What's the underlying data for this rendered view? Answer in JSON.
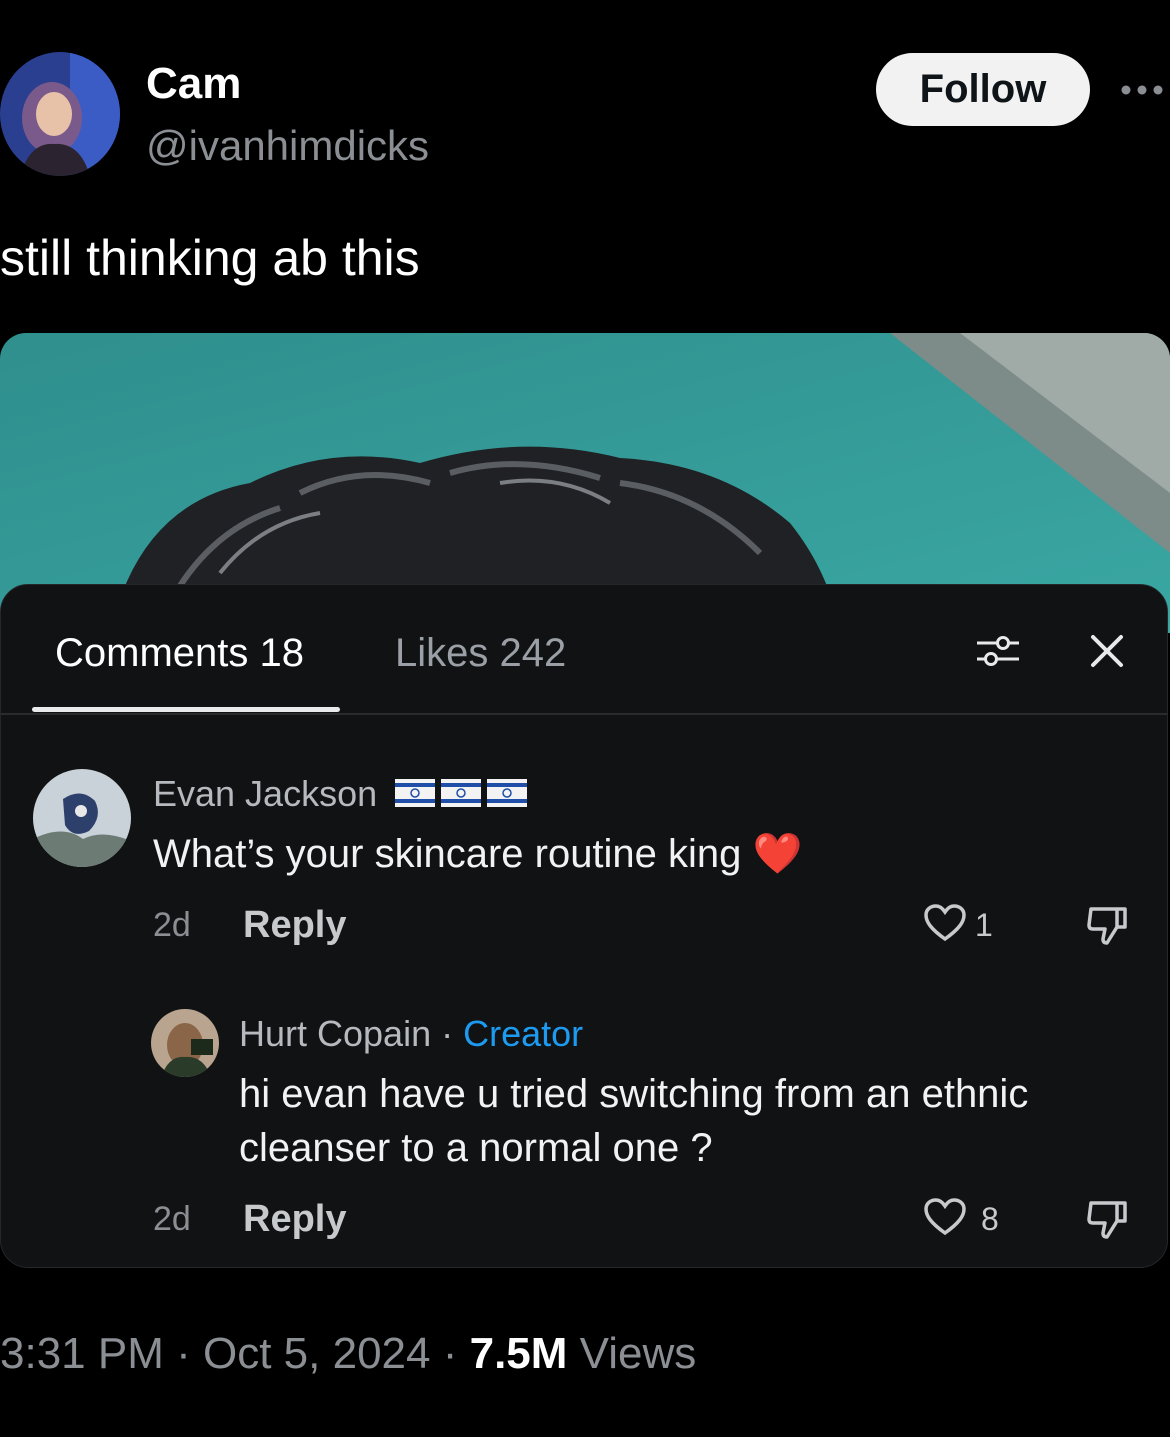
{
  "tweet": {
    "author": {
      "display_name": "Cam",
      "handle": "@ivanhimdicks"
    },
    "follow_label": "Follow",
    "text": "still thinking ab this"
  },
  "comments_panel": {
    "tabs": [
      {
        "label": "Comments 18"
      },
      {
        "label": "Likes 242"
      }
    ],
    "comments": [
      {
        "author": "Evan Jackson",
        "badge_icons": [
          "israel-flag-icon",
          "israel-flag-icon",
          "israel-flag-icon"
        ],
        "text": "What’s your skincare routine king",
        "emoji": "❤️",
        "age": "2d",
        "reply_label": "Reply",
        "likes": "1"
      },
      {
        "author": "Hurt Copain",
        "separator": "·",
        "role": "Creator",
        "text_line1": "hi evan have u tried switching from an ethnic",
        "text_line2": "cleanser to a normal one ?",
        "age": "2d",
        "reply_label": "Reply",
        "likes": "8"
      }
    ]
  },
  "footer": {
    "time": "3:31 PM",
    "date": "Oct 5, 2024",
    "views_count": "7.5M",
    "views_label": "Views",
    "separator": "·"
  },
  "colors": {
    "background": "#000000",
    "sheet": "#111214",
    "creator_accent": "#1d9bf0",
    "heart_emoji": "#ff3b30"
  }
}
